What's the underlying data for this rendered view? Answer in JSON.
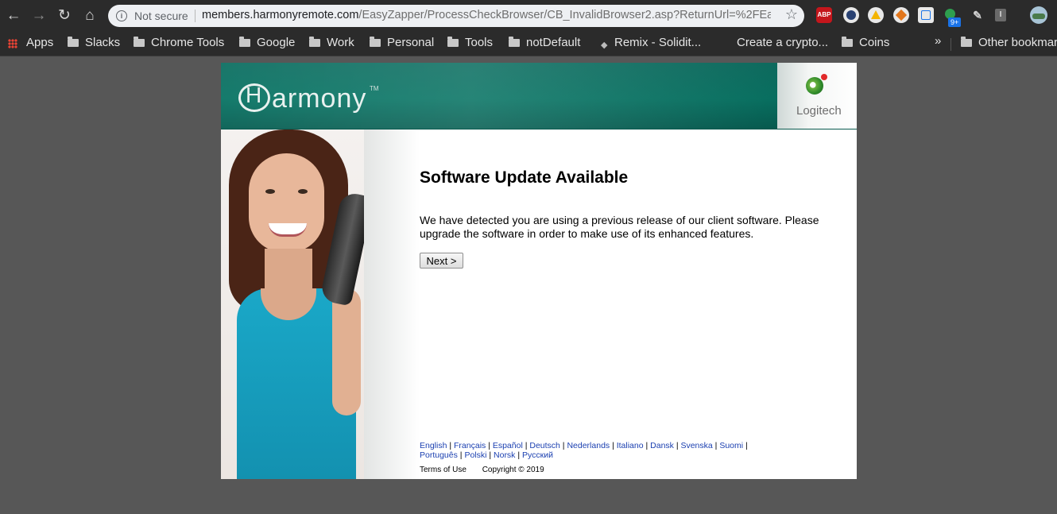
{
  "browser": {
    "security_label": "Not secure",
    "url_host": "members.harmonyremote.com",
    "url_path": "/EasyZapper/ProcessCheckBrowser/CB_InvalidBrowser2.asp?ReturnUrl=%2FEas...",
    "extension_badge": "9+",
    "extensions": [
      "adblock-plus-icon",
      "fedora-icon",
      "google-drive-icon",
      "metamask-icon",
      "tab-manager-icon",
      "green-dot-icon",
      "pencil-icon",
      "reader-icon"
    ]
  },
  "bookmarks": {
    "items": [
      {
        "label": "Apps",
        "type": "apps"
      },
      {
        "label": "Slacks",
        "type": "folder"
      },
      {
        "label": "Chrome Tools",
        "type": "folder"
      },
      {
        "label": "Google",
        "type": "folder"
      },
      {
        "label": "Work",
        "type": "folder"
      },
      {
        "label": "Personal",
        "type": "folder"
      },
      {
        "label": "Tools",
        "type": "folder"
      },
      {
        "label": "notDefault",
        "type": "folder"
      },
      {
        "label": "Remix - Solidit...",
        "type": "link"
      },
      {
        "label": "Create a crypto...",
        "type": "link"
      },
      {
        "label": "Coins",
        "type": "folder"
      }
    ],
    "overflow": "»",
    "other": "Other bookmarks"
  },
  "page": {
    "brand": "armony",
    "brand_tm": "TM",
    "logitech": "Logitech",
    "title": "Software Update Available",
    "message": "We have detected you are using a previous release of our client software. Please upgrade the software in order to make use of its enhanced features.",
    "next_button": "Next >",
    "languages": [
      "English",
      "Français",
      "Español",
      "Deutsch",
      "Nederlands",
      "Italiano",
      "Dansk",
      "Svenska",
      "Suomi",
      "Português",
      "Polski",
      "Norsk",
      "Русский"
    ],
    "terms": "Terms of Use",
    "copyright": "Copyright © 2019"
  },
  "colors": {
    "header_green": "#087464",
    "link_blue": "#1a3fb0",
    "chrome_dark": "#2b2b2b"
  }
}
